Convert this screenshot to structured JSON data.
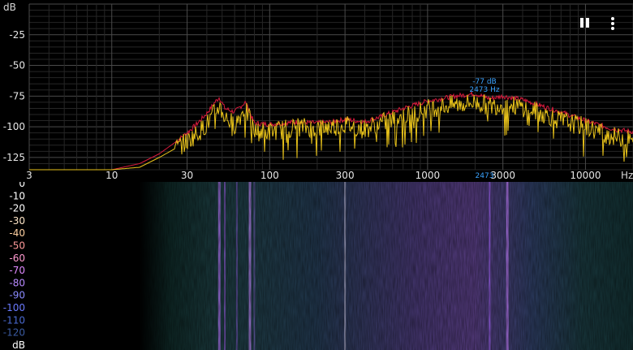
{
  "spectrum": {
    "unit_label": "dB",
    "x_unit_label": "Hz",
    "y_ticks": [
      "-25",
      "-50",
      "-75",
      "-100",
      "-125"
    ],
    "x_ticks": [
      "3",
      "10",
      "30",
      "100",
      "300",
      "1000",
      "3000",
      "10000"
    ],
    "peak_marker": {
      "db_text": "-77 dB",
      "freq_text": "2473 Hz",
      "axis_text": "2473",
      "freq_hz": 2473,
      "db": -77
    },
    "colors": {
      "current": "#e8c21a",
      "peak_hold": "#d81a3c",
      "grid": "#3a3a3a",
      "marker": "#3aa3ff"
    }
  },
  "spectrogram": {
    "scale_labels": [
      "0",
      "-10",
      "-20",
      "-30",
      "-40",
      "-50",
      "-60",
      "-70",
      "-80",
      "-90",
      "-100",
      "-110",
      "-120",
      "dB"
    ],
    "scale_colors": [
      "#ffffff",
      "#ffffff",
      "#ffffff",
      "#ffe6c8",
      "#ffd0a0",
      "#ff9a9a",
      "#ff9ad0",
      "#e08aff",
      "#b88aff",
      "#8a8aff",
      "#6a7aff",
      "#4a6ad0",
      "#3a5aa0",
      "#ffffff"
    ]
  },
  "controls": {
    "pause_icon": "pause-icon",
    "menu_icon": "more-vert-icon"
  },
  "chart_data": {
    "type": "line",
    "xlabel": "Hz",
    "ylabel": "dB",
    "xscale": "log",
    "xlim": [
      3,
      20000
    ],
    "ylim": [
      -135,
      0
    ],
    "grid": true,
    "series": [
      {
        "x": [
          3,
          10,
          15,
          20,
          25,
          30,
          35,
          40,
          45,
          48,
          52,
          60,
          70,
          80,
          100,
          150,
          200,
          250,
          300,
          400,
          500,
          700,
          1000,
          1500,
          2000,
          2473,
          3000,
          4000,
          5000,
          7000,
          10000,
          15000,
          20000
        ],
        "values": [
          -135,
          -135,
          -133,
          -125,
          -118,
          -112,
          -105,
          -98,
          -88,
          -83,
          -92,
          -98,
          -85,
          -104,
          -104,
          -100,
          -101,
          -100,
          -98,
          -102,
          -97,
          -92,
          -85,
          -82,
          -80,
          -83,
          -82,
          -84,
          -88,
          -95,
          -100,
          -108,
          -111
        ],
        "color": "#e8c21a"
      },
      {
        "x": [
          3,
          10,
          15,
          20,
          25,
          30,
          35,
          40,
          45,
          48,
          52,
          60,
          70,
          80,
          100,
          150,
          200,
          250,
          300,
          400,
          500,
          700,
          1000,
          1500,
          2000,
          2473,
          3000,
          4000,
          5000,
          7000,
          10000,
          15000,
          20000
        ],
        "values": [
          -135,
          -135,
          -130,
          -122,
          -113,
          -105,
          -97,
          -89,
          -80,
          -76,
          -85,
          -88,
          -80,
          -97,
          -98,
          -96,
          -97,
          -96,
          -94,
          -96,
          -92,
          -85,
          -79,
          -75,
          -73,
          -77,
          -75,
          -78,
          -82,
          -88,
          -95,
          -102,
          -104
        ],
        "color": "#d81a3c"
      }
    ]
  }
}
